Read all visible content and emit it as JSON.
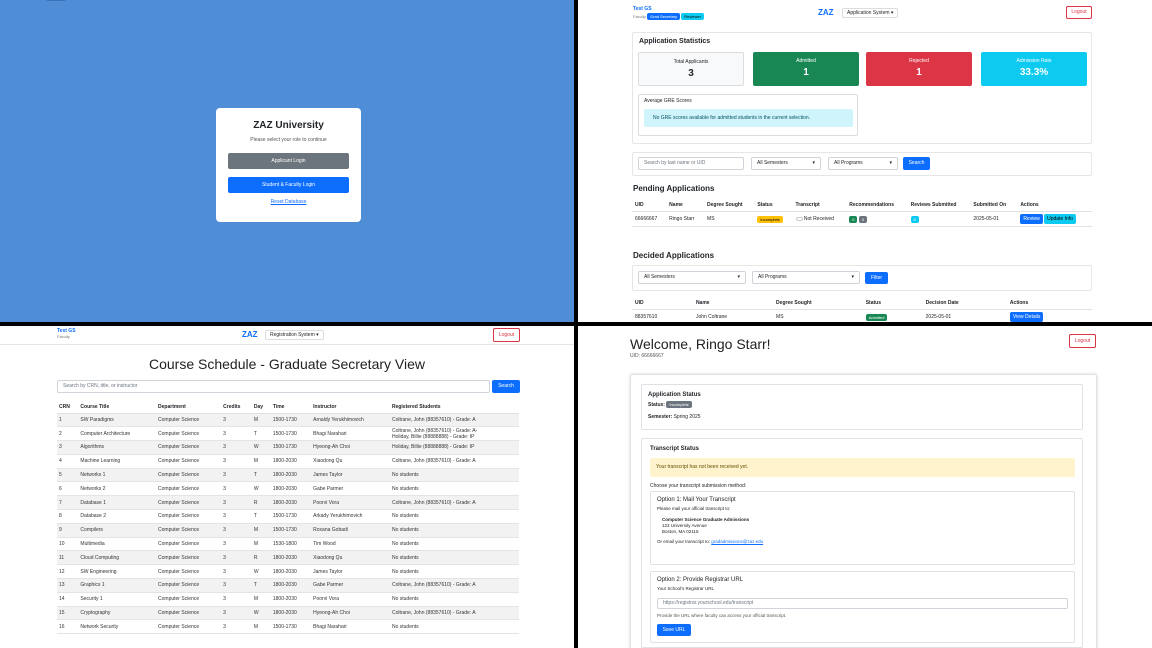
{
  "login": {
    "title": "ZAZ University",
    "subtitle": "Please select your role to continue",
    "applicant_btn": "Applicant Login",
    "faculty_btn": "Student & Faculty Login",
    "reset_link": "Reset Database"
  },
  "secretary": {
    "user": {
      "name": "Test GS",
      "role": "Faculty",
      "badge1": "Grad Secretary",
      "badge2": "Reviewer"
    },
    "brand": "ZAZ",
    "system": "Application System",
    "logout": "Logout",
    "stats_title": "Application Statistics",
    "stats": [
      {
        "label": "Total Applicants",
        "value": "3"
      },
      {
        "label": "Admitted",
        "value": "1"
      },
      {
        "label": "Rejected",
        "value": "1"
      },
      {
        "label": "Admission Rate",
        "value": "33.3%"
      }
    ],
    "gre_title": "Average GRE Scores",
    "gre_msg": "No GRE scores available for admitted students in the current selection.",
    "search_placeholder": "Search by last name or UID",
    "sem": "All Semesters",
    "prog": "All Programs",
    "search_btn": "Search",
    "pending_title": "Pending Applications",
    "pending_headers": [
      "UID",
      "Name",
      "Degree Sought",
      "Status",
      "Transcript",
      "Recommendations",
      "Reviews Submitted",
      "Submitted On",
      "Actions"
    ],
    "pending_row": {
      "uid": "66666667",
      "name": "Ringo Starr",
      "degree": "MS",
      "status": "Incomplete",
      "transcript": "Not Received",
      "rec1": "0",
      "rec2": "0",
      "reviews": "0",
      "date": "2025-05-01",
      "review_btn": "Review",
      "update_btn": "Update Info"
    },
    "decided_title": "Decided Applications",
    "filter_btn": "Filter",
    "decided_headers": [
      "UID",
      "Name",
      "Degree Sought",
      "Status",
      "Decision Date",
      "Actions"
    ],
    "decided_row": {
      "uid": "88357610",
      "name": "John Coltrane",
      "degree": "MS",
      "status": "Admitted",
      "date": "2025-05-01",
      "btn": "View Details"
    }
  },
  "schedule": {
    "user": {
      "name": "Test GS",
      "role": "Faculty"
    },
    "brand": "ZAZ",
    "system": "Registration System",
    "logout": "Logout",
    "title": "Course Schedule - Graduate Secretary View",
    "search_placeholder": "Search by CRN, title, or instructor",
    "search_btn": "Search",
    "headers": [
      "CRN",
      "Course Title",
      "Department",
      "Credits",
      "Day",
      "Time",
      "Instructor",
      "Registered Students"
    ],
    "rows": [
      [
        "1",
        "SW Paradigms",
        "Computer Science",
        "3",
        "M",
        "1500-1730",
        "Arnaldy Yerukhimovich",
        "Coltrane, John (88357610) - Grade: A"
      ],
      [
        "2",
        "Computer Architecture",
        "Computer Science",
        "3",
        "T",
        "1500-1730",
        "Bhagi Narahari",
        "Coltrane, John (88357610) - Grade: A-\nHoliday, Billie (88888888) - Grade: IP"
      ],
      [
        "3",
        "Algorithms",
        "Computer Science",
        "3",
        "W",
        "1500-1730",
        "Hyeong-Ah Choi",
        "Holiday, Billie (88888888) - Grade: IP"
      ],
      [
        "4",
        "Machine Learning",
        "Computer Science",
        "3",
        "M",
        "1800-2030",
        "Xiaodong Qu",
        "Coltrane, John (88357610) - Grade: A"
      ],
      [
        "5",
        "Networks 1",
        "Computer Science",
        "3",
        "T",
        "1800-2030",
        "James Taylor",
        "No students"
      ],
      [
        "6",
        "Networks 2",
        "Computer Science",
        "3",
        "W",
        "1800-2030",
        "Gabe Parmer",
        "No students"
      ],
      [
        "7",
        "Database 1",
        "Computer Science",
        "3",
        "R",
        "1800-2030",
        "Poorvi Vora",
        "Coltrane, John (88357610) - Grade: A"
      ],
      [
        "8",
        "Database 2",
        "Computer Science",
        "3",
        "T",
        "1500-1730",
        "Arkady Yerukhimovich",
        "No students"
      ],
      [
        "9",
        "Compilers",
        "Computer Science",
        "3",
        "M",
        "1500-1730",
        "Roxana Gobadi",
        "No students"
      ],
      [
        "10",
        "Multimedia",
        "Computer Science",
        "3",
        "M",
        "1530-1800",
        "Tim Wood",
        "No students"
      ],
      [
        "11",
        "Cloud Computing",
        "Computer Science",
        "3",
        "R",
        "1800-2030",
        "Xiaodong Qu",
        "No students"
      ],
      [
        "12",
        "SW Engineering",
        "Computer Science",
        "3",
        "W",
        "1800-2030",
        "James Taylor",
        "No students"
      ],
      [
        "13",
        "Graphics 1",
        "Computer Science",
        "3",
        "T",
        "1800-2030",
        "Gabe Parmer",
        "Coltrane, John (88357610) - Grade: A"
      ],
      [
        "14",
        "Security 1",
        "Computer Science",
        "3",
        "M",
        "1800-2030",
        "Poorvi Vora",
        "No students"
      ],
      [
        "15",
        "Cryptography",
        "Computer Science",
        "3",
        "W",
        "1800-2030",
        "Hyeong-Ah Choi",
        "Coltrane, John (88357610) - Grade: A"
      ],
      [
        "16",
        "Network Security",
        "Computer Science",
        "3",
        "M",
        "1500-1730",
        "Bhagi Narahari",
        "No students"
      ]
    ]
  },
  "applicant": {
    "welcome": "Welcome, Ringo Starr!",
    "uid": "UID: 66666667",
    "logout": "Logout",
    "app_status_title": "Application Status",
    "status_label": "Status:",
    "status_badge": "Incomplete",
    "semester_label": "Semester:",
    "semester_value": "Spring 2025",
    "transcript_title": "Transcript Status",
    "transcript_alert": "Your transcript has not been received yet.",
    "choose_method": "Choose your transcript submission method:",
    "opt1_title": "Option 1: Mail Your Transcript",
    "opt1_text": "Please mail your official transcript to:",
    "addr1": "Computer Science Graduate Admissions",
    "addr2": "123 University Avenue",
    "addr3": "Boston, MA 02115",
    "email_text": "Or email your transcript to:",
    "email": "gradadmissions@zaz.edu",
    "opt2_title": "Option 2: Provide Registrar URL",
    "opt2_label": "Your School's Registrar URL",
    "url_placeholder": "https://registrar.yourschool.edu/transcript",
    "opt2_help": "Provide the URL where faculty can access your official transcript.",
    "save_btn": "Save URL"
  },
  "colors": {
    "primary": "#0d6efd",
    "success": "#198754",
    "danger": "#dc3545",
    "info": "#0dcaf0",
    "warning": "#ffc107",
    "login_bg": "#4f8ed6"
  }
}
